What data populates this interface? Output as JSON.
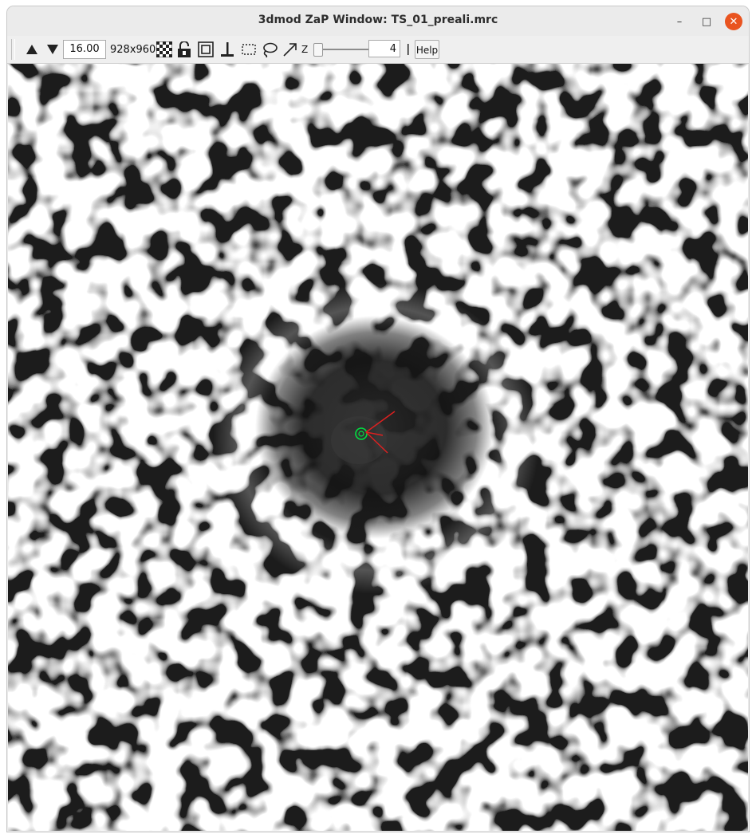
{
  "window": {
    "title": "3dmod ZaP Window: TS_01_preali.mrc",
    "minimize_glyph": "–",
    "maximize_glyph": "□",
    "close_glyph": "✕"
  },
  "toolbar": {
    "zoom_value": "16.00",
    "image_size": "928x960",
    "z_label": "Z",
    "section_value": "4",
    "help_label": "Help",
    "icons": [
      "section-up-icon",
      "section-down-icon",
      "interpolation-icon",
      "lock-icon",
      "center-icon",
      "insert-point-icon",
      "rubberband-icon",
      "lasso-icon",
      "arrow-icon"
    ]
  },
  "viewport": {
    "marker_color": "#00e040",
    "arrow_color": "#e02020"
  }
}
